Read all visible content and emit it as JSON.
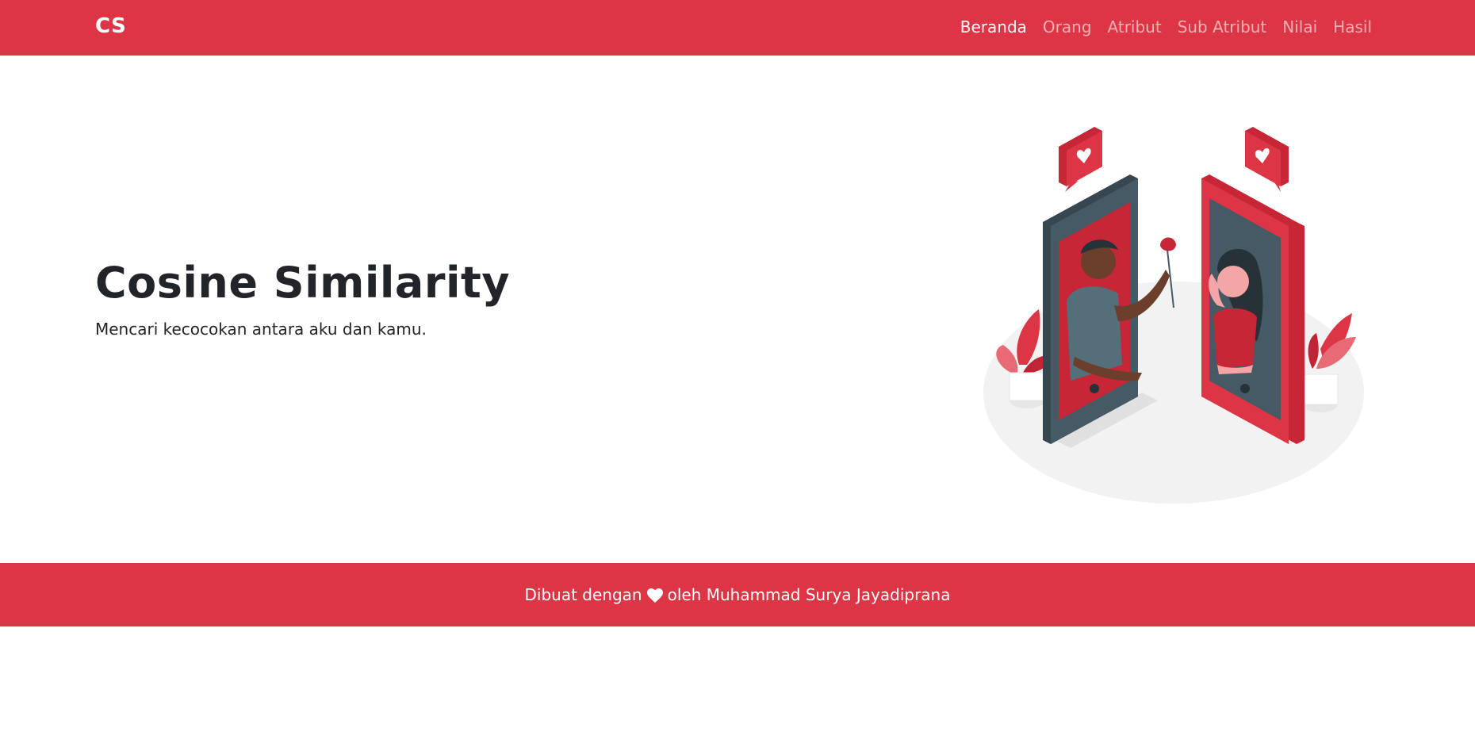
{
  "navbar": {
    "brand": "CS",
    "links": [
      {
        "label": "Beranda",
        "active": true
      },
      {
        "label": "Orang",
        "active": false
      },
      {
        "label": "Atribut",
        "active": false
      },
      {
        "label": "Sub Atribut",
        "active": false
      },
      {
        "label": "Nilai",
        "active": false
      },
      {
        "label": "Hasil",
        "active": false
      }
    ]
  },
  "hero": {
    "title": "Cosine Similarity",
    "subtitle": "Mencari kecocokan antara aku dan kamu."
  },
  "footer": {
    "prefix": "Dibuat dengan",
    "icon": "heart-icon",
    "suffix": "oleh Muhammad Surya Jayadiprana"
  },
  "colors": {
    "accent": "#dc3545",
    "text": "#212529",
    "navText": "#ffffff",
    "illustrationDark": "#455a64",
    "illustrationFloor": "#f2f2f2"
  }
}
